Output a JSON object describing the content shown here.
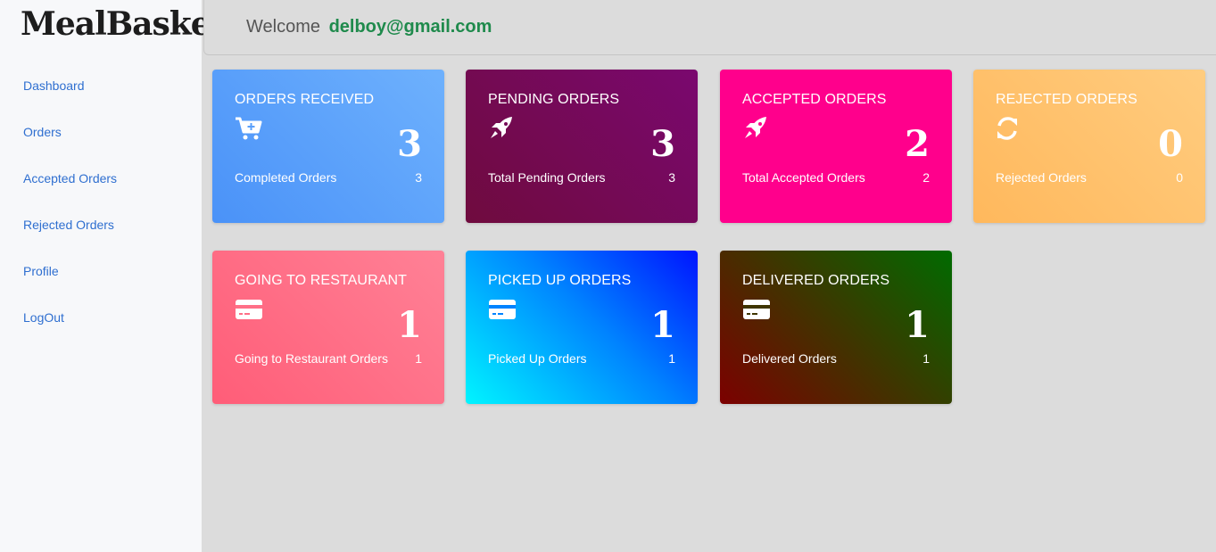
{
  "sidebar": {
    "brand": "MealBasket",
    "items": [
      {
        "label": "Dashboard"
      },
      {
        "label": "Orders"
      },
      {
        "label": "Accepted Orders"
      },
      {
        "label": "Rejected Orders"
      },
      {
        "label": "Profile"
      },
      {
        "label": "LogOut"
      }
    ]
  },
  "header": {
    "welcome": "Welcome",
    "email": "delboy@gmail.com"
  },
  "cards": [
    {
      "title": "ORDERS RECEIVED",
      "icon": "cart-plus-icon",
      "count": "3",
      "sub_label": "Completed Orders",
      "sub_value": "3"
    },
    {
      "title": "PENDING ORDERS",
      "icon": "rocket-icon",
      "count": "3",
      "sub_label": "Total Pending Orders",
      "sub_value": "3"
    },
    {
      "title": "ACCEPTED ORDERS",
      "icon": "rocket-icon",
      "count": "2",
      "sub_label": "Total Accepted Orders",
      "sub_value": "2"
    },
    {
      "title": "REJECTED ORDERS",
      "icon": "refresh-icon",
      "count": "0",
      "sub_label": "Rejected Orders",
      "sub_value": "0"
    },
    {
      "title": "GOING TO RESTAURANT",
      "icon": "credit-card-icon",
      "count": "1",
      "sub_label": "Going to Restaurant Orders",
      "sub_value": "1"
    },
    {
      "title": "PICKED UP ORDERS",
      "icon": "credit-card-icon",
      "count": "1",
      "sub_label": "Picked Up Orders",
      "sub_value": "1"
    },
    {
      "title": "DELIVERED ORDERS",
      "icon": "credit-card-icon",
      "count": "1",
      "sub_label": "Delivered Orders",
      "sub_value": "1"
    }
  ],
  "colors": {
    "accent_link": "#2f6fd0",
    "email": "#1f8a4c",
    "received": "#5aa0fb",
    "pending": "#750a57",
    "accepted": "#ff008c",
    "rejected": "#ffc26e",
    "going": "#ff6f87",
    "picked": "#0083ff",
    "delivered": "#3f3500"
  }
}
